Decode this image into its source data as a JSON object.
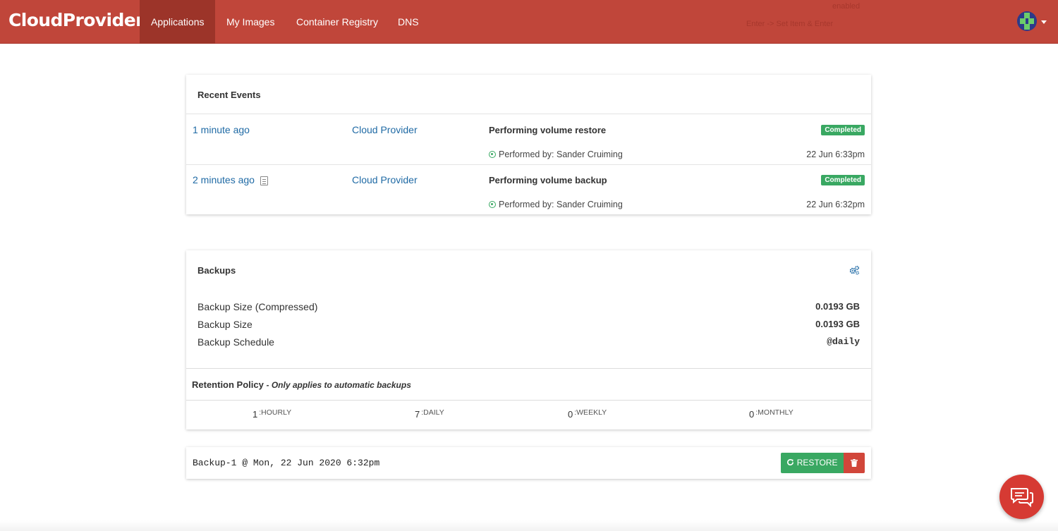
{
  "navbar": {
    "brand": "CloudProvider",
    "tabs": [
      {
        "label": "Applications",
        "active": true
      },
      {
        "label": "My Images"
      },
      {
        "label": "Container Registry"
      },
      {
        "label": "DNS"
      }
    ],
    "ghost_text": [
      "enabled",
      "Enter -> Set Item & Enter"
    ],
    "accent_color": "#c0463a"
  },
  "events": {
    "title": "Recent Events",
    "rows": [
      {
        "time_ago": "1 minute ago",
        "source": "Cloud Provider",
        "title": "Performing volume restore",
        "status": "Completed",
        "performed_by": "Performed by: Sander Cruiming",
        "timestamp": "22 Jun 6:33pm"
      },
      {
        "time_ago": "2 minutes ago",
        "source": "Cloud Provider",
        "title": "Performing volume backup",
        "status": "Completed",
        "performed_by": "Performed by: Sander Cruiming",
        "timestamp": "22 Jun 6:32pm"
      }
    ]
  },
  "backups": {
    "title": "Backups",
    "size_compressed_label": "Backup Size (Compressed)",
    "size_compressed_value": "0.0193 GB",
    "size_label": "Backup Size",
    "size_value": "0.0193 GB",
    "schedule_label": "Backup Schedule",
    "schedule_value": "@daily",
    "retention": {
      "title": "Retention Policy",
      "note": "- Only applies to automatic backups",
      "items": [
        {
          "value": "1",
          "unit": ":HOURLY"
        },
        {
          "value": "7",
          "unit": ":DAILY"
        },
        {
          "value": "0",
          "unit": ":WEEKLY"
        },
        {
          "value": "0",
          "unit": ":MONTHLY"
        }
      ]
    }
  },
  "backup_item": {
    "name": "Backup-1 @ Mon, 22 Jun 2020 6:32pm",
    "restore_label": "RESTORE"
  }
}
